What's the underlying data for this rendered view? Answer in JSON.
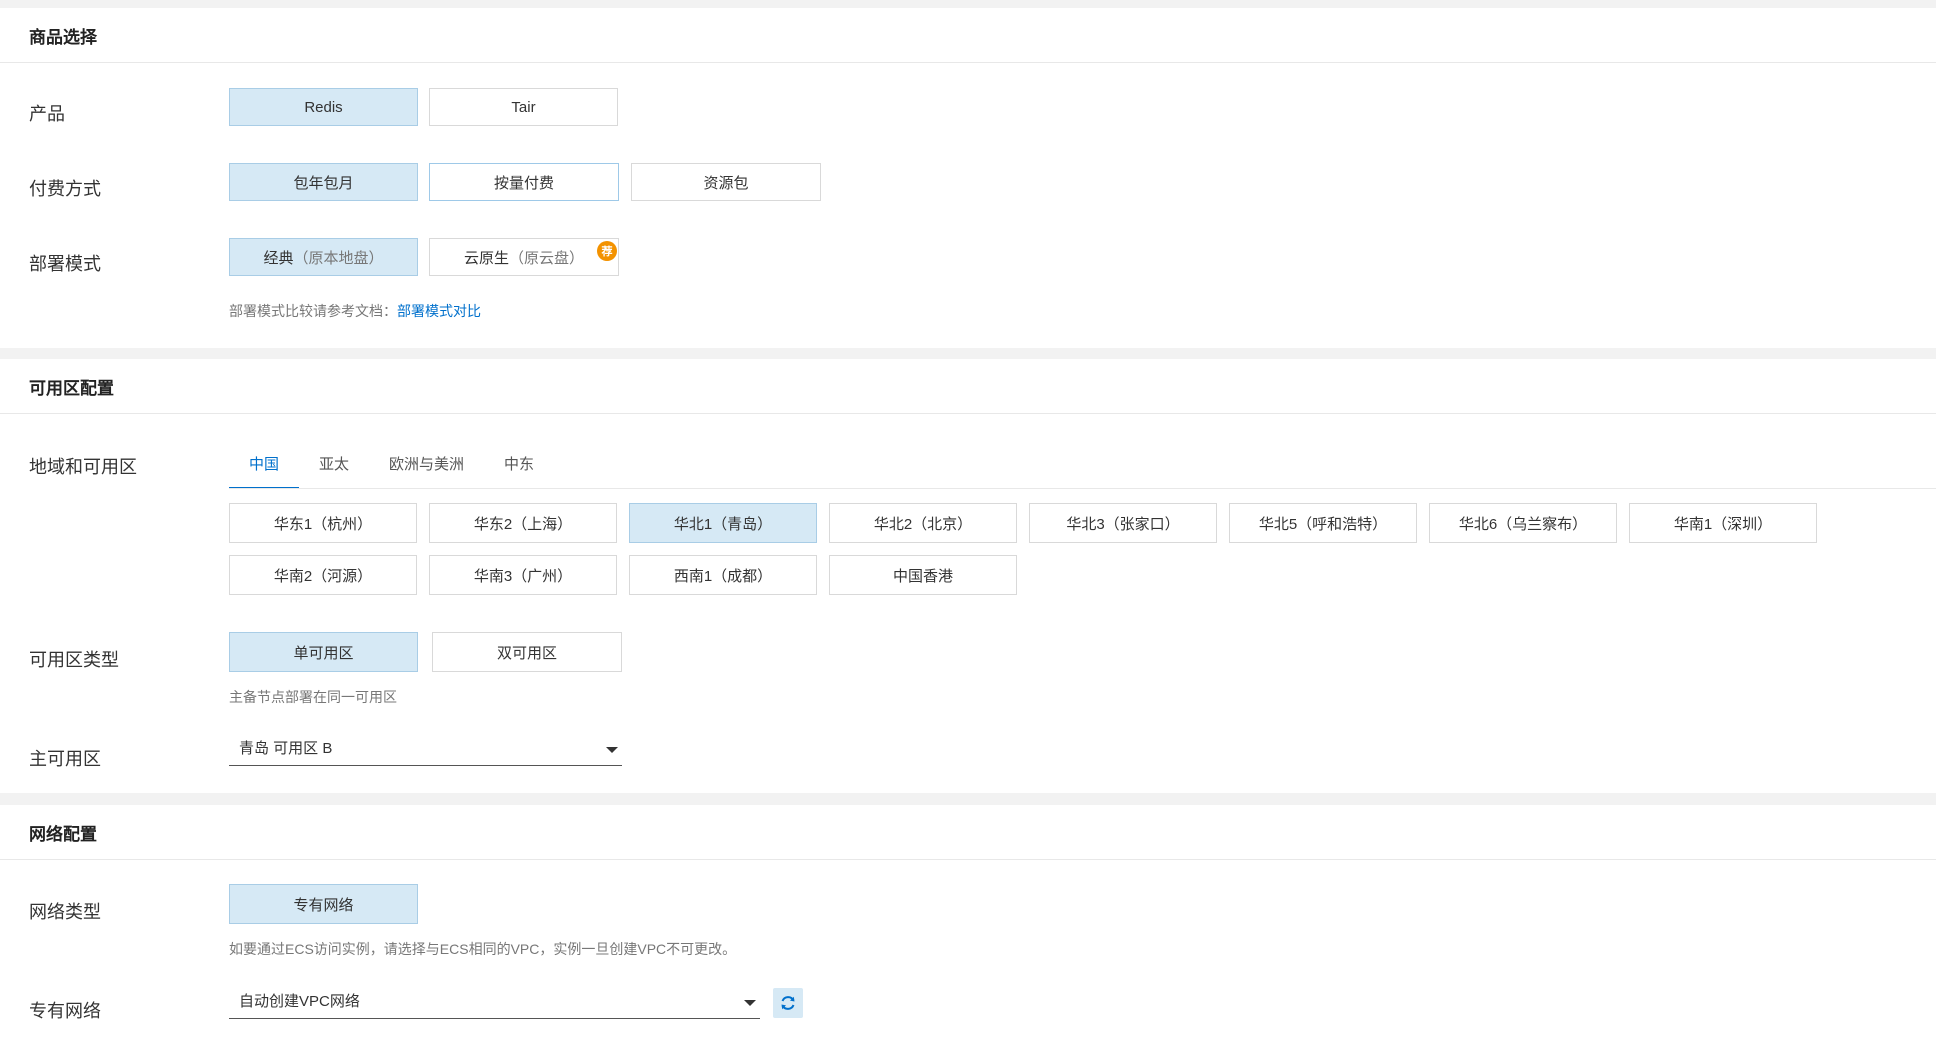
{
  "product_section": {
    "title": "商品选择",
    "product": {
      "label": "产品",
      "options": [
        "Redis",
        "Tair"
      ],
      "selected": "Redis"
    },
    "billing": {
      "label": "付费方式",
      "options": [
        "包年包月",
        "按量付费",
        "资源包"
      ],
      "selected": "包年包月"
    },
    "deploy": {
      "label": "部署模式",
      "options": [
        {
          "main": "经典",
          "sub": "（原本地盘）"
        },
        {
          "main": "云原生",
          "sub": "（原云盘）",
          "badge": "荐"
        }
      ],
      "selected": "经典",
      "hint_text": "部署模式比较请参考文档：",
      "hint_link": "部署模式对比"
    }
  },
  "zone_section": {
    "title": "可用区配置",
    "region": {
      "label": "地域和可用区",
      "tabs": [
        "中国",
        "亚太",
        "欧洲与美洲",
        "中东"
      ],
      "active_tab": "中国",
      "regions_row1": [
        "华东1（杭州）",
        "华东2（上海）",
        "华北1（青岛）",
        "华北2（北京）",
        "华北3（张家口）",
        "华北5（呼和浩特）",
        "华北6（乌兰察布）",
        "华南1（深圳）"
      ],
      "regions_row2": [
        "华南2（河源）",
        "华南3（广州）",
        "西南1（成都）",
        "中国香港"
      ],
      "selected": "华北1（青岛）"
    },
    "zone_type": {
      "label": "可用区类型",
      "options": [
        "单可用区",
        "双可用区"
      ],
      "selected": "单可用区",
      "hint": "主备节点部署在同一可用区"
    },
    "primary_zone": {
      "label": "主可用区",
      "value": "青岛 可用区 B"
    }
  },
  "network_section": {
    "title": "网络配置",
    "network_type": {
      "label": "网络类型",
      "options": [
        "专有网络"
      ],
      "selected": "专有网络",
      "hint": "如要通过ECS访问实例，请选择与ECS相同的VPC，实例一旦创建VPC不可更改。"
    },
    "vpc": {
      "label": "专有网络",
      "value": "自动创建VPC网络"
    }
  },
  "colors": {
    "accent": "#0070cc",
    "selected_bg": "#d6e9f5",
    "badge": "#f39200"
  },
  "icons": {
    "refresh": "refresh-icon",
    "dropdown": "chevron-down-icon"
  }
}
